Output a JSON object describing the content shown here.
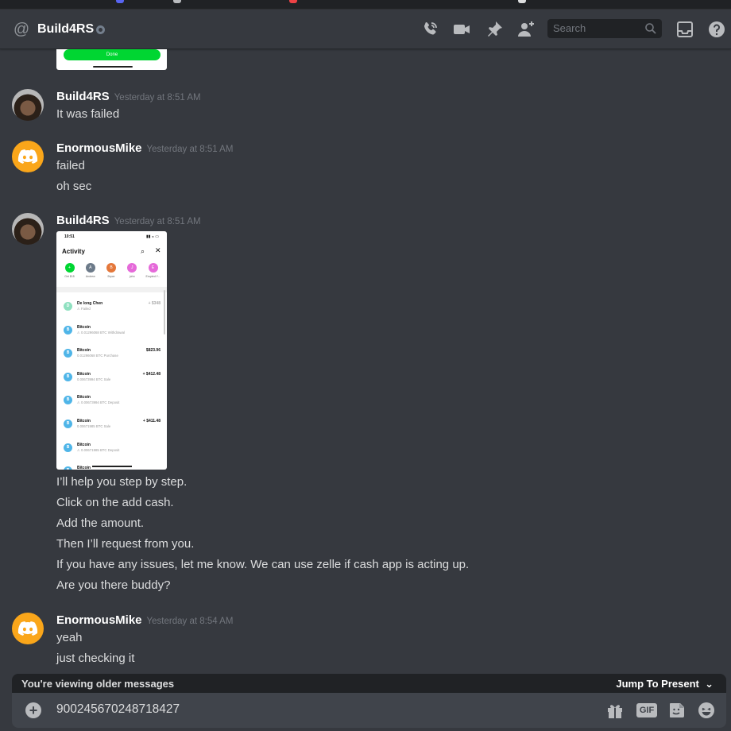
{
  "header": {
    "title": "Build4RS",
    "search_placeholder": "Search"
  },
  "messages": {
    "group1": {
      "author": "Build4RS",
      "timestamp": "Yesterday at 8:51 AM",
      "lines": [
        "It was failed"
      ]
    },
    "group2": {
      "author": "EnormousMike",
      "timestamp": "Yesterday at 8:51 AM",
      "lines": [
        "failed",
        "oh sec"
      ]
    },
    "group3": {
      "author": "Build4RS",
      "timestamp": "Yesterday at 8:51 AM",
      "lines": [
        "I’ll help you step by step.",
        "Click on the add cash.",
        "Add the amount.",
        "Then I’ll request from you.",
        "If you have any issues, let me know. We can use zelle if cash app is acting up.",
        "Are you there buddy?"
      ]
    },
    "group4": {
      "author": "EnormousMike",
      "timestamp": "Yesterday at 8:54 AM",
      "lines": [
        "yeah",
        "just checking it"
      ]
    }
  },
  "attachment_top": {
    "button_label": "Done"
  },
  "phone": {
    "time": "10:51",
    "title": "Activity",
    "contacts": [
      {
        "label": "Get $15",
        "initial": "+",
        "color": "#00d632"
      },
      {
        "label": "Andrew",
        "initial": "A",
        "color": "#6c7a89"
      },
      {
        "label": "Bryce",
        "initial": "B",
        "color": "#e4773a"
      },
      {
        "label": "john",
        "initial": "J",
        "color": "#e56ad9"
      },
      {
        "label": "Erupted Y...",
        "initial": "E",
        "color": "#e56ad9"
      }
    ],
    "rows": [
      {
        "name": "De long Chen",
        "sub": "⚠ Failed",
        "amount": "+ $348",
        "icon": "D",
        "color": "#8fe0c0"
      },
      {
        "name": "Bitcoin",
        "sub": "⚠ 0.01296068 BTC Withdrawal",
        "amount": "",
        "icon": "B",
        "color": "#4fb5e8"
      },
      {
        "name": "Bitcoin",
        "sub": "0.01296068 BTC Purchase",
        "amount": "$823.96",
        "icon": "B",
        "color": "#4fb5e8"
      },
      {
        "name": "Bitcoin",
        "sub": "0.00673994 BTC Sale",
        "amount": "+ $412.48",
        "icon": "B",
        "color": "#4fb5e8"
      },
      {
        "name": "Bitcoin",
        "sub": "⚠ 0.00673994 BTC Deposit",
        "amount": "",
        "icon": "B",
        "color": "#4fb5e8"
      },
      {
        "name": "Bitcoin",
        "sub": "0.00671985 BTC Sale",
        "amount": "+ $411.48",
        "icon": "B",
        "color": "#4fb5e8"
      },
      {
        "name": "Bitcoin",
        "sub": "⚠ 0.00671985 BTC Deposit",
        "amount": "",
        "icon": "B",
        "color": "#4fb5e8"
      },
      {
        "name": "Bitcoin",
        "sub": "",
        "amount": "",
        "icon": "B",
        "color": "#4fb5e8"
      }
    ]
  },
  "older_bar": {
    "label": "You're viewing older messages",
    "jump_label": "Jump To Present"
  },
  "composer": {
    "value": "900245670248718427",
    "gif_label": "GIF"
  },
  "colors": {
    "background": "#36393f",
    "discord_avatar": "#faa61a",
    "cashapp_green": "#00d632"
  }
}
